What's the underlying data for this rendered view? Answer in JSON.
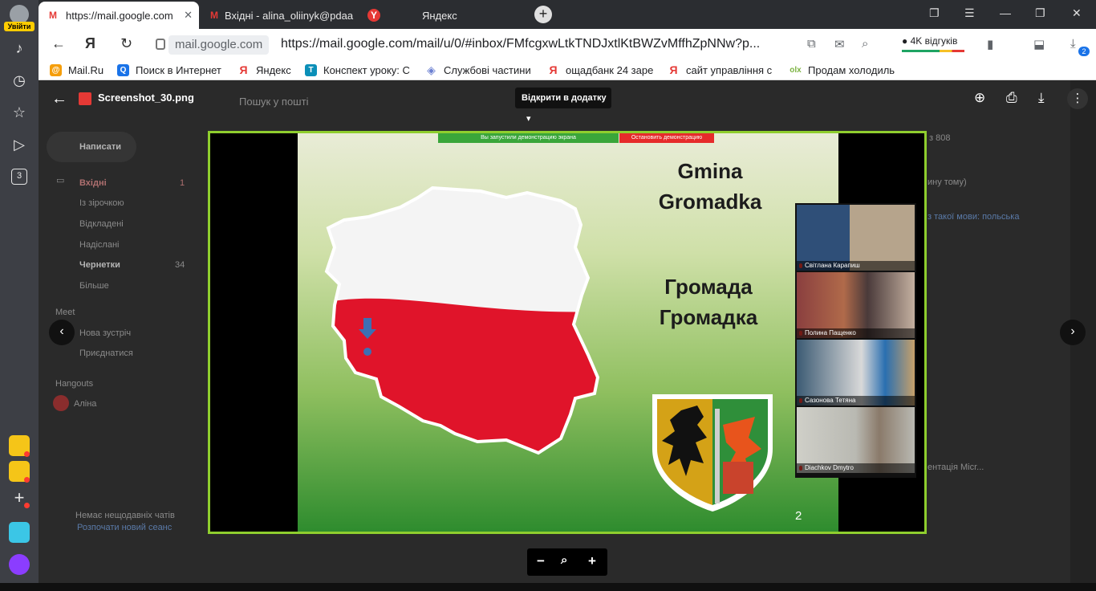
{
  "browser": {
    "login_label": "Увійти",
    "rail_counter": "3",
    "tabs": [
      {
        "label": "https://mail.google.com",
        "favicon": "gmail-icon"
      },
      {
        "label": "Вхідні - alina_oliinyk@pdaa",
        "favicon": "gmail-icon"
      },
      {
        "label": "Яндекс",
        "favicon": "yandex-icon"
      }
    ],
    "domain": "mail.google.com",
    "url": "https://mail.google.com/mail/u/0/#inbox/FMfcgxwLtkTNDJxtlKtBWZvMffhZpNNw?p...",
    "reviews_label": "4K відгуків",
    "downloads_badge": "2",
    "bookmarks": [
      {
        "label": "Mail.Ru",
        "color": "#f59e0b"
      },
      {
        "label": "Поиск в Интернет",
        "color": "#1a73e8"
      },
      {
        "label": "Яндекс",
        "color": "#e53935"
      },
      {
        "label": "Конспект уроку: С",
        "color": "#0b8fb8"
      },
      {
        "label": "Службові частини",
        "color": "#6a7fd1"
      },
      {
        "label": "ощадбанк 24 заре",
        "color": "#e53935"
      },
      {
        "label": "сайт управління с",
        "color": "#e53935"
      },
      {
        "label": "Продам холодиль",
        "color": "#7cb342"
      }
    ]
  },
  "gmail": {
    "search_placeholder": "Пошук у пошті",
    "compose_label": "Написати",
    "nav": [
      {
        "label": "Вхідні",
        "count": "1"
      },
      {
        "label": "Із зірочкою",
        "count": ""
      },
      {
        "label": "Відкладені",
        "count": ""
      },
      {
        "label": "Надіслані",
        "count": ""
      },
      {
        "label": "Чернетки",
        "count": "34"
      },
      {
        "label": "Більше",
        "count": ""
      }
    ],
    "meet_header": "Meet",
    "meet_items": [
      "Нова зустріч",
      "Приєднатися"
    ],
    "hangouts_header": "Hangouts",
    "hangouts_user": "Аліна",
    "no_chats": "Немає нещодавніх чатів",
    "start_chat": "Розпочати новий сеанс",
    "right_snippets": [
      "з 808",
      "ину тому)",
      "з такої мови: польська",
      "ентація Micr..."
    ]
  },
  "viewer": {
    "filename": "Screenshot_30.png",
    "open_in_label": "Відкрити в додатку",
    "slide": {
      "demo_bar_text": "Вы запустили демонстрацию экрана",
      "demo_stop_text": "Остановить демонстрацию",
      "title_latin": [
        "Gmina",
        "Gromadka"
      ],
      "title_cyrillic": [
        "Громада",
        "Громадка"
      ],
      "slide_number": "2",
      "participants": [
        {
          "name": "Світлана Карапиш",
          "bg": "#7a8a9c"
        },
        {
          "name": "Полина Пащенко",
          "bg": "#8a3f3f"
        },
        {
          "name": "Сазонова Тетяна",
          "bg": "#3c5b74"
        },
        {
          "name": "Diachkov Dmytro",
          "bg": "#b9b9b2"
        }
      ]
    }
  }
}
